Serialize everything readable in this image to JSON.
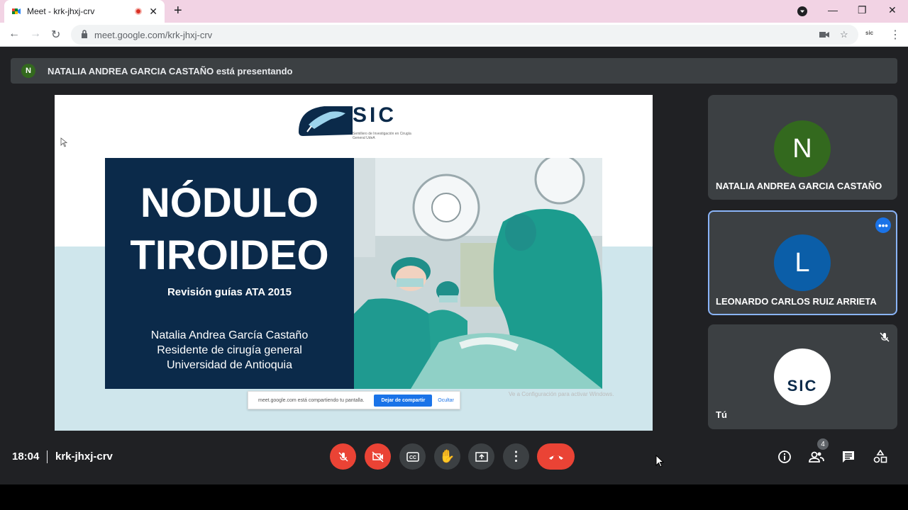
{
  "browser": {
    "tab_title": "Meet - krk-jhxj-crv",
    "url": "meet.google.com/krk-jhxj-crv",
    "extension_label": "sic"
  },
  "banner": {
    "initial": "N",
    "text": "NATALIA ANDREA GARCIA CASTAÑO está presentando"
  },
  "slide": {
    "logo_text": "SIC",
    "logo_subtitle": "Semillero de Investigación en Cirugía General UdeA",
    "title_line1": "NÓDULO",
    "title_line2": "TIROIDEO",
    "subtitle": "Revisión guías ATA 2015",
    "author_line1": "Natalia Andrea García Castaño",
    "author_line2": "Residente de cirugía general",
    "author_line3": "Universidad de Antioquia",
    "share_notice": "meet.google.com está compartiendo tu pantalla.",
    "share_stop": "Dejar de compartir",
    "share_hide": "Ocultar",
    "watermark": "Ve a Configuración para activar Windows."
  },
  "participants": [
    {
      "initial": "N",
      "name": "NATALIA ANDREA GARCIA CASTAÑO",
      "color": "#33691e"
    },
    {
      "initial": "L",
      "name": "LEONARDO CARLOS RUIZ ARRIETA",
      "color": "#0b5ea8"
    },
    {
      "avatar_text": "SIC",
      "name": "Tú"
    }
  ],
  "controls": {
    "time": "18:04",
    "meeting_code": "krk-jhxj-crv",
    "people_count": "4"
  }
}
